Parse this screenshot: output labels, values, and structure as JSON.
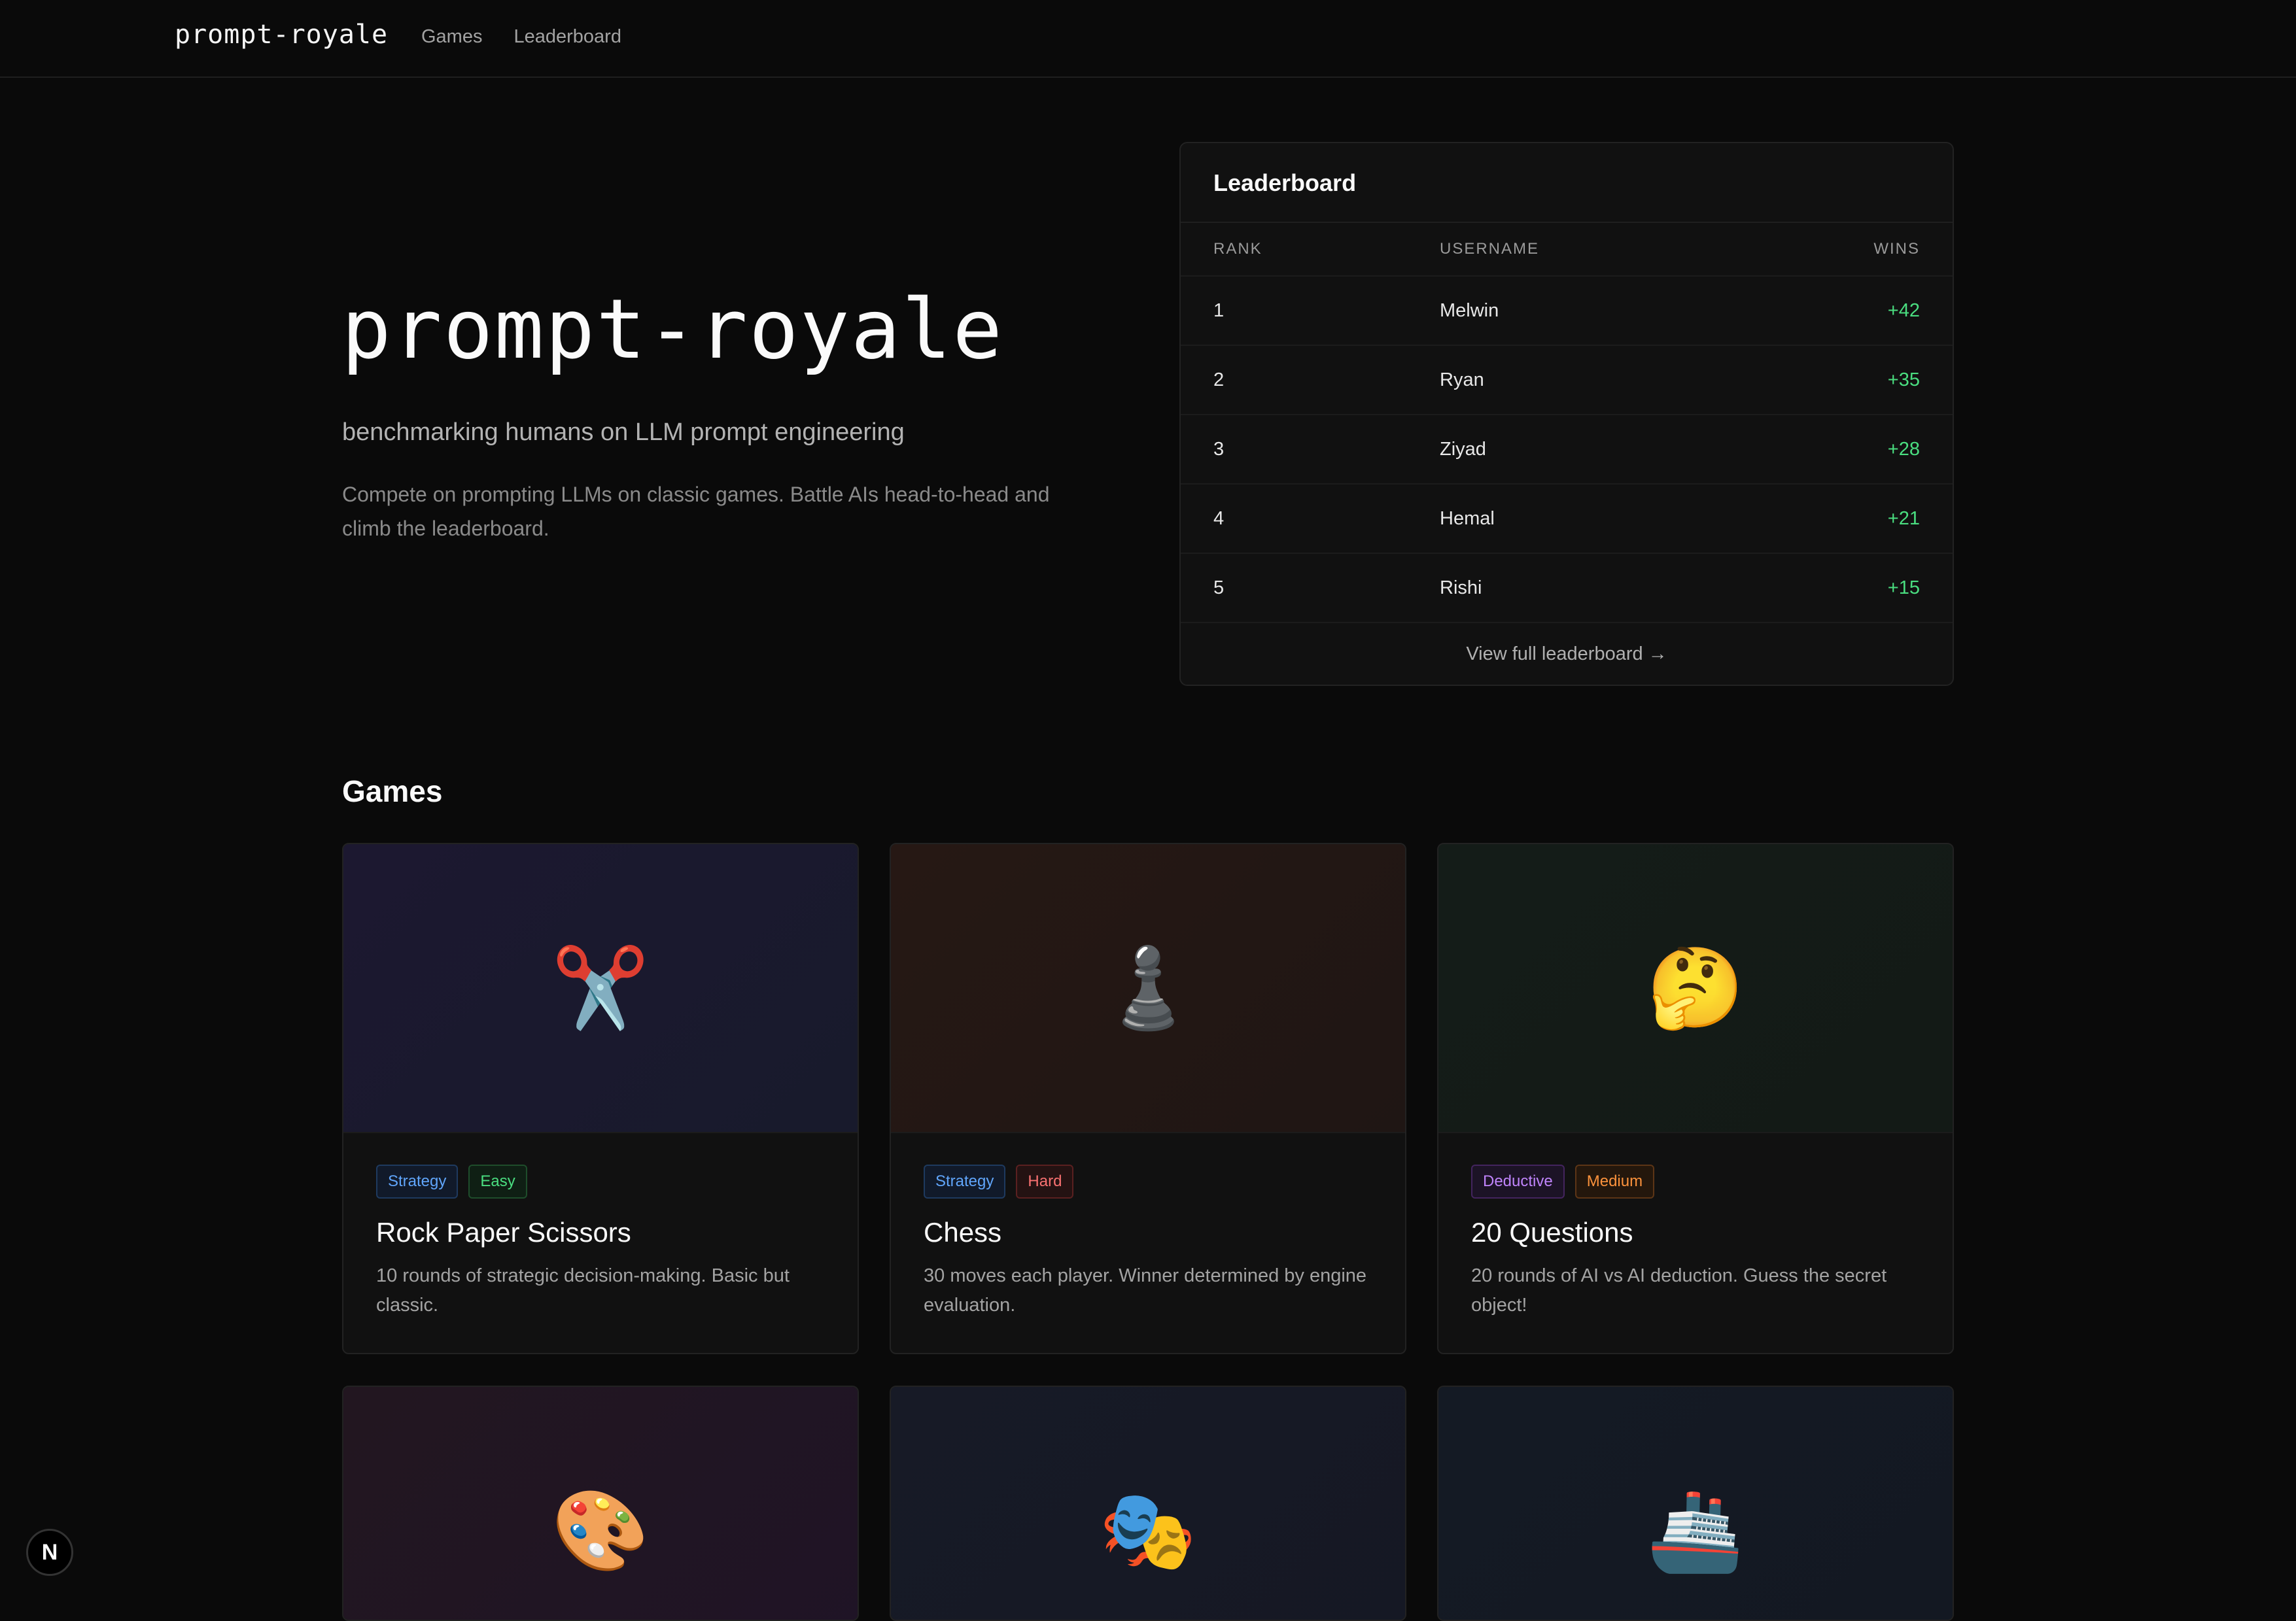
{
  "nav": {
    "brand": "prompt-royale",
    "links": [
      "Games",
      "Leaderboard"
    ]
  },
  "hero": {
    "title": "prompt-royale",
    "subtitle": "benchmarking humans on LLM prompt engineering",
    "description": "Compete on prompting LLMs on classic games. Battle AIs head-to-head and climb the leaderboard."
  },
  "leaderboard": {
    "title": "Leaderboard",
    "columns": {
      "rank": "RANK",
      "username": "USERNAME",
      "wins": "WINS"
    },
    "rows": [
      {
        "rank": "1",
        "username": "Melwin",
        "wins": "+42"
      },
      {
        "rank": "2",
        "username": "Ryan",
        "wins": "+35"
      },
      {
        "rank": "3",
        "username": "Ziyad",
        "wins": "+28"
      },
      {
        "rank": "4",
        "username": "Hemal",
        "wins": "+21"
      },
      {
        "rank": "5",
        "username": "Rishi",
        "wins": "+15"
      }
    ],
    "footer_link": "View full leaderboard →"
  },
  "games": {
    "title": "Games",
    "cards": [
      {
        "emoji": "✂️",
        "tags": [
          "Strategy",
          "Easy"
        ],
        "name": "Rock Paper Scissors",
        "description": "10 rounds of strategic decision-making. Basic but classic."
      },
      {
        "emoji": "♟️",
        "tags": [
          "Strategy",
          "Hard"
        ],
        "name": "Chess",
        "description": "30 moves each player. Winner determined by engine evaluation."
      },
      {
        "emoji": "🤔",
        "tags": [
          "Deductive",
          "Medium"
        ],
        "name": "20 Questions",
        "description": "20 rounds of AI vs AI deduction. Guess the secret object!"
      },
      {
        "emoji": "🎨"
      },
      {
        "emoji": "🎭"
      },
      {
        "emoji": "🚢"
      }
    ]
  },
  "dev_badge": "N",
  "colors": {
    "background": "#0a0a0a",
    "card": "#111111",
    "wins_green": "#4ade80",
    "tag_strategy": "#60a5fa",
    "tag_easy": "#4ade80",
    "tag_hard": "#f87171",
    "tag_deductive": "#c084fc",
    "tag_medium": "#fb923c"
  }
}
